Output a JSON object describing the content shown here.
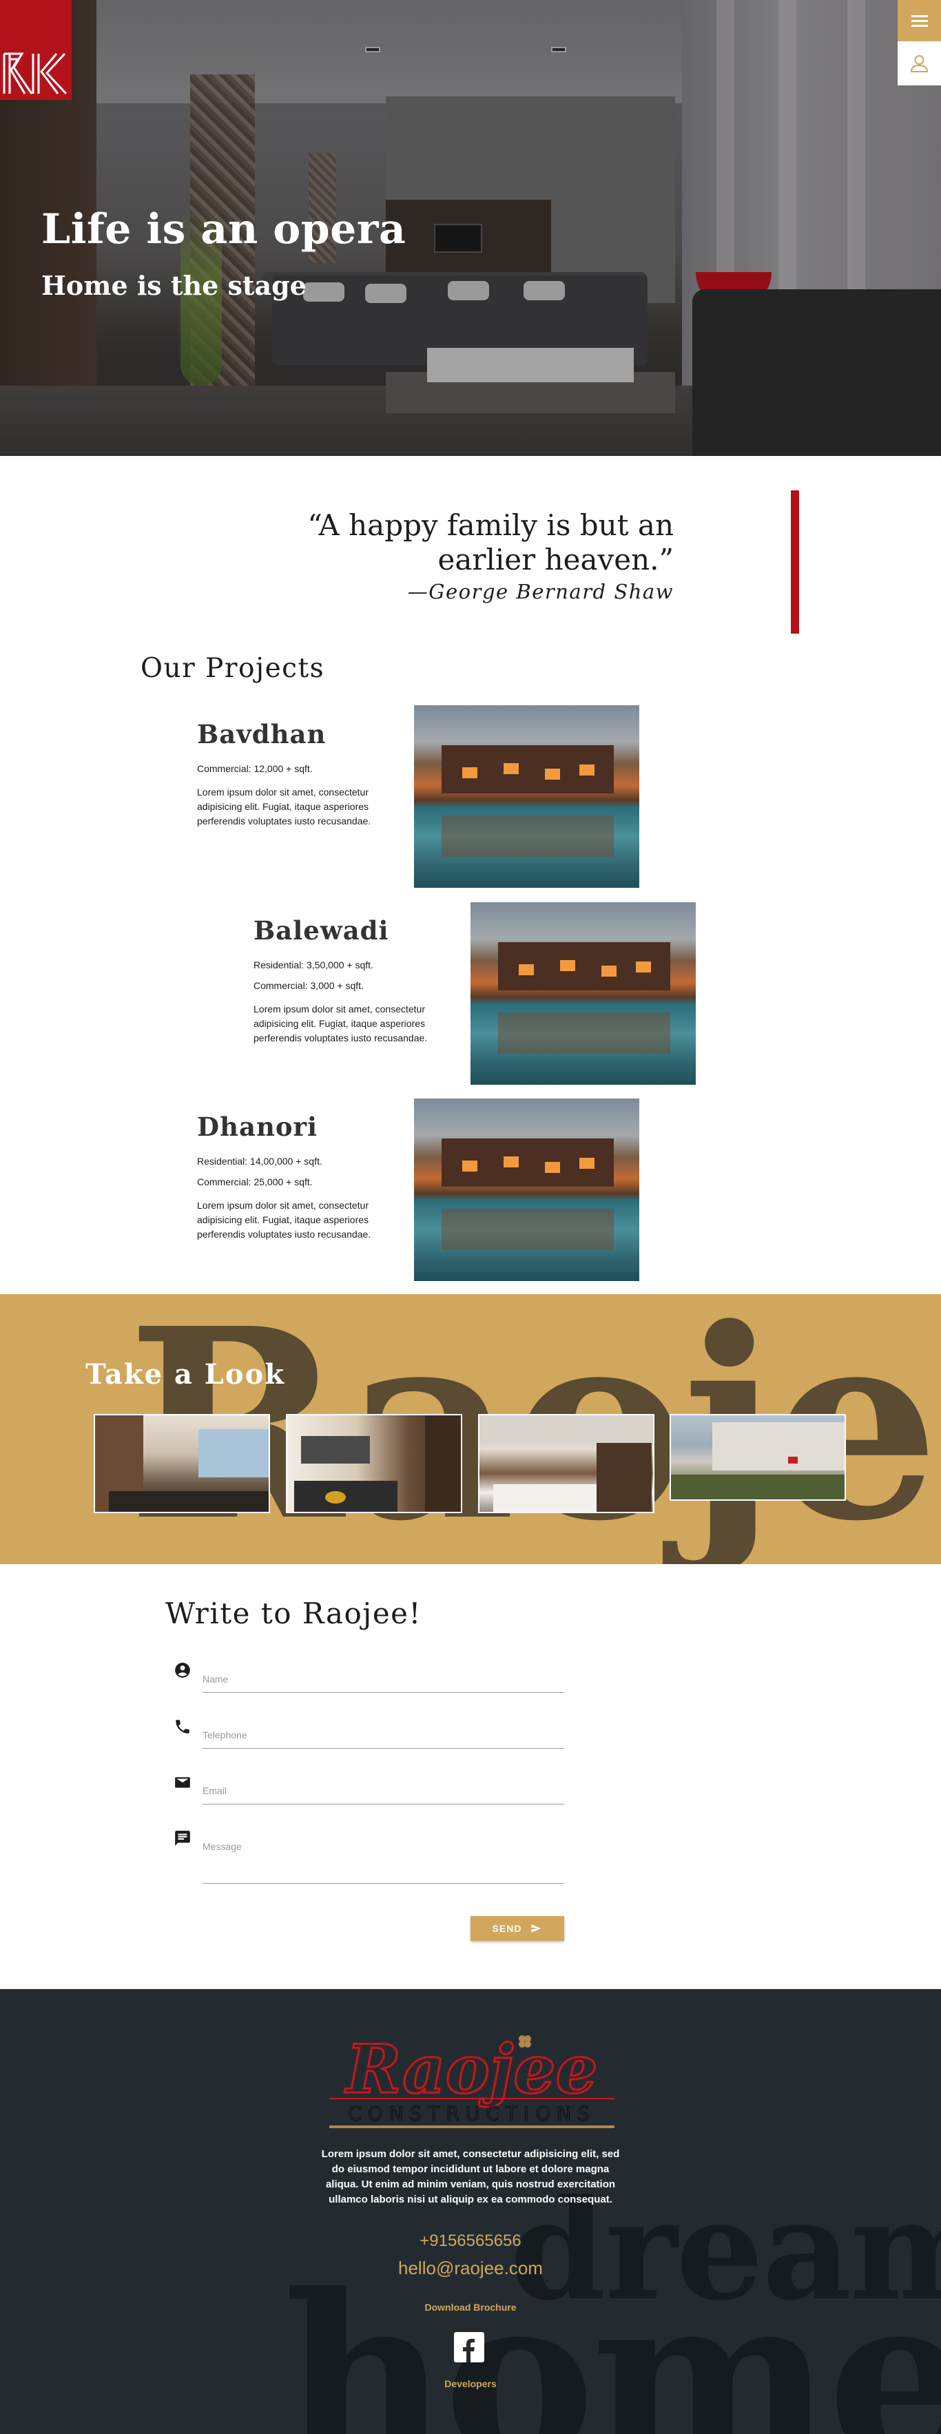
{
  "hero": {
    "title": "Life is an opera",
    "subtitle": "Home is the stage"
  },
  "nav": {
    "menu_icon": "hamburger-menu-icon",
    "user_icon": "user-icon"
  },
  "colors": {
    "brand_red": "#b4121a",
    "gold": "#d1a75e",
    "footer_bg": "#242b30"
  },
  "quote": {
    "text": "“A happy family is but an earlier heaven.”",
    "author": "—George Bernard Shaw"
  },
  "projects": {
    "title": "Our Projects",
    "items": [
      {
        "name": "Bavdhan",
        "meta": [
          "Commercial: 12,000 + sqft."
        ],
        "desc": "Lorem ipsum dolor sit amet, consectetur adipisicing elit. Fugiat, itaque asperiores perferendis voluptates iusto recusandae."
      },
      {
        "name": "Balewadi",
        "meta": [
          "Residential: 3,50,000 + sqft.",
          "Commercial: 3,000 + sqft."
        ],
        "desc": "Lorem ipsum dolor sit amet, consectetur adipisicing elit. Fugiat, itaque asperiores perferendis voluptates iusto recusandae."
      },
      {
        "name": "Dhanori",
        "meta": [
          "Residential: 14,00,000 + sqft.",
          "Commercial: 25,000 + sqft."
        ],
        "desc": "Lorem ipsum dolor sit amet, consectetur adipisicing elit. Fugiat, itaque asperiores perferendis voluptates iusto recusandae."
      }
    ]
  },
  "look": {
    "title": "Take a Look",
    "bg_word": "Raojee"
  },
  "contact": {
    "title": "Write to Raojee!",
    "name_placeholder": "Name",
    "phone_placeholder": "Telephone",
    "email_placeholder": "Email",
    "message_placeholder": "Message",
    "send_label": "SEND"
  },
  "footer": {
    "logo_word": "Raojee",
    "logo_sub": "CONSTRUCTIONS",
    "text": "Lorem ipsum dolor sit amet, consectetur adipisicing elit, sed do eiusmod tempor incididunt ut labore et dolore magna aliqua. Ut enim ad minim veniam, quis nostrud exercitation ullamco laboris nisi ut aliquip ex ea commodo consequat.",
    "phone": "+9156565656",
    "email": "hello@raojee.com",
    "brochure": "Download Brochure",
    "developers": "Developers",
    "bg_word_1": "dream",
    "bg_word_2": "home"
  }
}
